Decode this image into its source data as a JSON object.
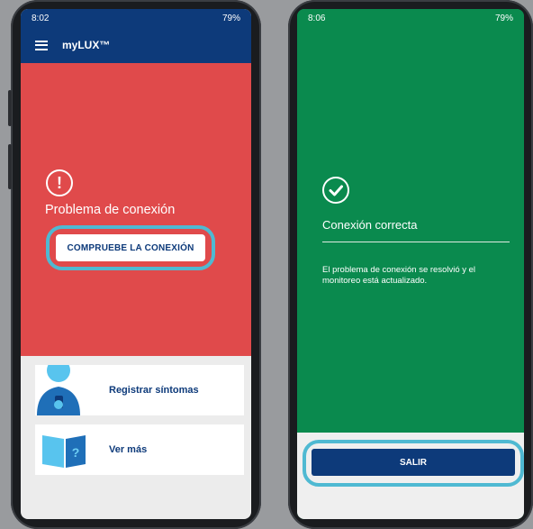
{
  "left_phone": {
    "status": {
      "time": "8:02",
      "battery": "79%"
    },
    "app_title": "myLUX™",
    "error": {
      "icon_glyph": "!",
      "title": "Problema de conexión",
      "button": "COMPRUEBE LA CONEXIÓN"
    },
    "cards": [
      {
        "label": "Registrar síntomas",
        "icon": "person-phone-illustration"
      },
      {
        "label": "Ver más",
        "icon": "book-illustration"
      }
    ]
  },
  "right_phone": {
    "status": {
      "time": "8:06",
      "battery": "79%"
    },
    "success": {
      "title": "Conexión correcta",
      "message": "El problema de conexión se resolvió y el monitoreo está actualizado."
    },
    "exit_button": "SALIR"
  },
  "colors": {
    "error_red": "#e04a4b",
    "success_green": "#0a8a4e",
    "brand_navy": "#0d3a7a",
    "highlight_cyan": "#4fb9d2"
  }
}
